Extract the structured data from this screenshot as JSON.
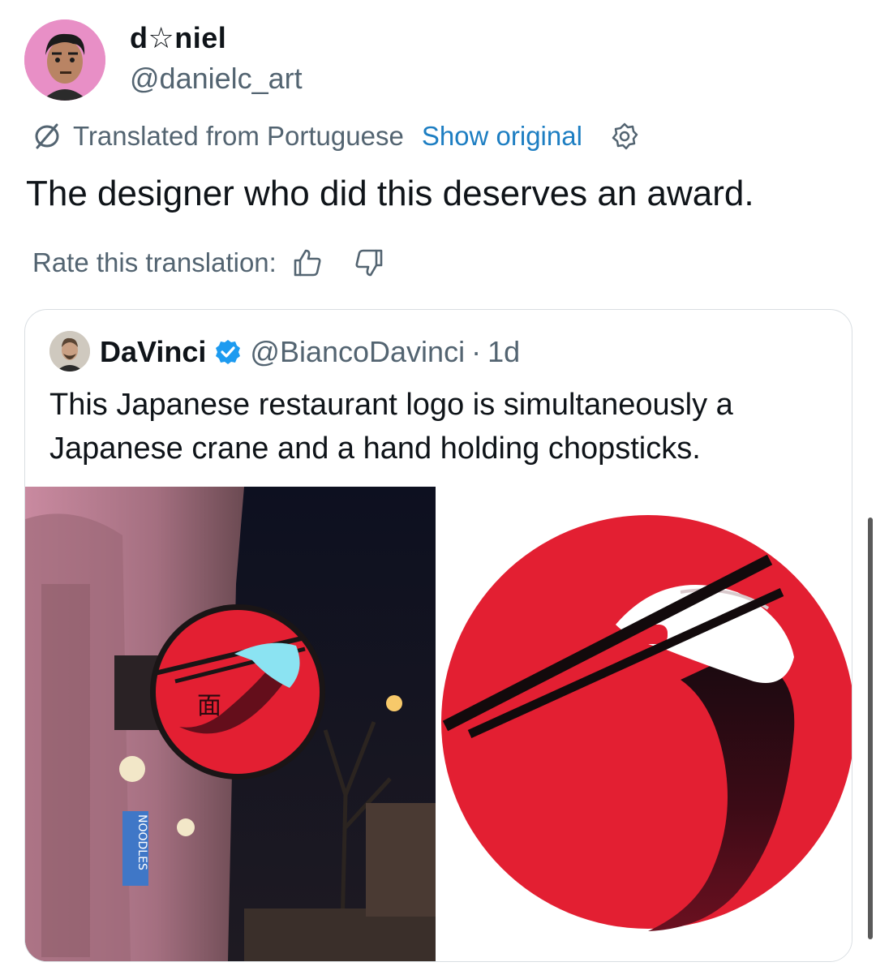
{
  "author": {
    "display_name": "d☆niel",
    "handle": "@danielc_art"
  },
  "translation": {
    "notice": "Translated from Portuguese",
    "show_original": "Show original",
    "rate_label": "Rate this translation:"
  },
  "tweet": {
    "text": "The designer who did this deserves an award."
  },
  "quote": {
    "name": "DaVinci",
    "handle": "@BiancoDavinci",
    "separator": "·",
    "time": "1d",
    "text": "This Japanese restaurant logo is simultaneously a Japanese crane and a hand holding chopsticks."
  },
  "photos": {
    "storefront_sign_text": "面",
    "storefront_banner_text": "NOODLES"
  },
  "colors": {
    "accent_link": "#1d7ec2",
    "muted_text": "#536471",
    "verified_blue": "#1d9bf0",
    "logo_red": "#e31f32",
    "avatar_pink": "#e88fc6"
  },
  "icons": [
    "translate-icon",
    "settings-icon",
    "thumbs-up-icon",
    "thumbs-down-icon",
    "verified-badge-icon"
  ]
}
